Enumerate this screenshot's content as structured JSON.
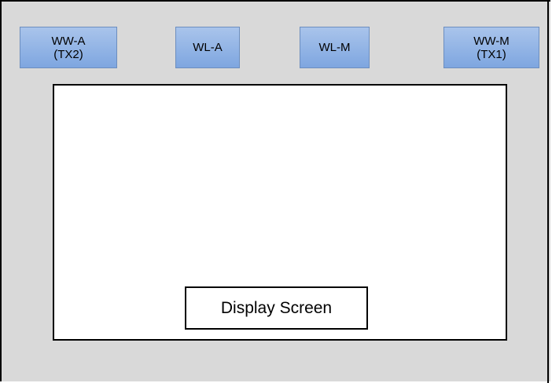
{
  "buttons": {
    "ww_a": {
      "line1": "WW-A",
      "line2": "(TX2)"
    },
    "wl_a": {
      "line1": "WL-A"
    },
    "wl_m": {
      "line1": "WL-M"
    },
    "ww_m": {
      "line1": "WW-M",
      "line2": "(TX1)"
    }
  },
  "display": {
    "label": "Display Screen"
  },
  "colors": {
    "panel_background": "#d9d9d9",
    "button_fill_top": "#a9c4eb",
    "button_fill_bottom": "#7ea6e0",
    "button_border": "#6c8ebf",
    "screen_background": "#ffffff",
    "outline": "#000000"
  }
}
